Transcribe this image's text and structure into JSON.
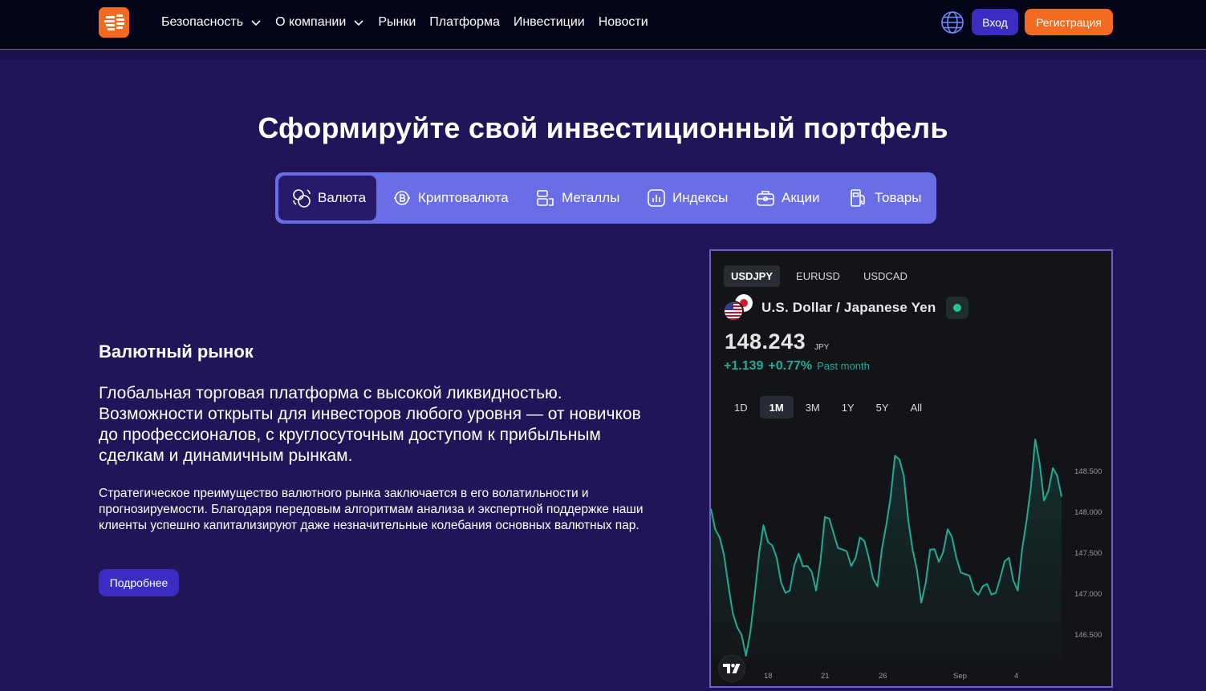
{
  "header": {
    "nav": [
      {
        "label": "Безопасность",
        "dropdown": true
      },
      {
        "label": "О компании",
        "dropdown": true
      },
      {
        "label": "Рынки",
        "dropdown": false
      },
      {
        "label": "Платформа",
        "dropdown": false
      },
      {
        "label": "Инвестиции",
        "dropdown": false
      },
      {
        "label": "Новости",
        "dropdown": false
      }
    ],
    "login_label": "Вход",
    "register_label": "Регистрация"
  },
  "hero": {
    "title": "Сформируйте свой инвестиционный портфель",
    "tabs": [
      {
        "label": "Валюта",
        "icon": "currency-icon",
        "active": true
      },
      {
        "label": "Криптовалюта",
        "icon": "bitcoin-icon",
        "active": false
      },
      {
        "label": "Металлы",
        "icon": "metal-bars-icon",
        "active": false
      },
      {
        "label": "Индексы",
        "icon": "index-chart-icon",
        "active": false
      },
      {
        "label": "Акции",
        "icon": "briefcase-icon",
        "active": false
      },
      {
        "label": "Товары",
        "icon": "fuel-pump-icon",
        "active": false
      }
    ]
  },
  "content": {
    "title": "Валютный рынок",
    "lead": "Глобальная торговая платформа с высокой ликвидностью. Возможности открыты для инвесторов любого уровня — от новичков до профессионалов, с круглосуточным доступом к прибыльным сделкам и динамичным рынкам.",
    "body": "Стратегическое преимущество валютного рынка заключается в его волатильности и прогнозируемости. Благодаря передовым алгоритмам анализа и экспертной поддержке наши клиенты успешно капитализируют даже незначительные колебания основных валютных пар.",
    "more_label": "Подробнее"
  },
  "widget": {
    "symbols": [
      {
        "label": "USDJPY",
        "active": true
      },
      {
        "label": "EURUSD",
        "active": false
      },
      {
        "label": "USDCAD",
        "active": false
      }
    ],
    "pair_name": "U.S. Dollar / Japanese Yen",
    "price": "148.243",
    "unit": "JPY",
    "change_abs": "+1.139",
    "change_pct": "+0.77%",
    "period": "Past month",
    "ranges": [
      {
        "label": "1D",
        "active": false
      },
      {
        "label": "1M",
        "active": true
      },
      {
        "label": "3M",
        "active": false
      },
      {
        "label": "1Y",
        "active": false
      },
      {
        "label": "5Y",
        "active": false
      },
      {
        "label": "All",
        "active": false
      }
    ],
    "colors": {
      "line": "#22ab94",
      "positive": "#22ab94",
      "background": "#131417"
    }
  },
  "chart_data": {
    "type": "area",
    "x_ticks": [
      "18",
      "21",
      "26",
      "Sep",
      "4"
    ],
    "y_ticks": [
      "148.500",
      "148.000",
      "147.500",
      "147.000",
      "146.500"
    ],
    "ylim": [
      146.3,
      148.95
    ],
    "x": [
      0,
      1,
      2,
      3,
      4,
      5,
      6,
      7,
      8,
      9,
      10,
      11,
      12,
      13,
      14,
      15,
      16,
      17,
      18,
      19,
      20,
      21,
      22,
      23,
      24,
      25,
      26,
      27,
      28,
      29,
      30,
      31,
      32,
      33,
      34,
      35,
      36,
      37,
      38,
      39,
      40
    ],
    "values": [
      148.05,
      147.7,
      147.1,
      146.6,
      146.25,
      147.0,
      147.85,
      147.6,
      147.15,
      147.05,
      147.5,
      147.35,
      147.05,
      147.95,
      147.75,
      147.55,
      147.35,
      147.7,
      147.45,
      147.1,
      147.85,
      148.7,
      148.45,
      147.55,
      146.9,
      147.55,
      147.4,
      147.8,
      147.45,
      147.25,
      147.05,
      147.1,
      147.0,
      147.2,
      147.45,
      147.05,
      147.9,
      148.9,
      148.15,
      148.55,
      148.2
    ]
  }
}
